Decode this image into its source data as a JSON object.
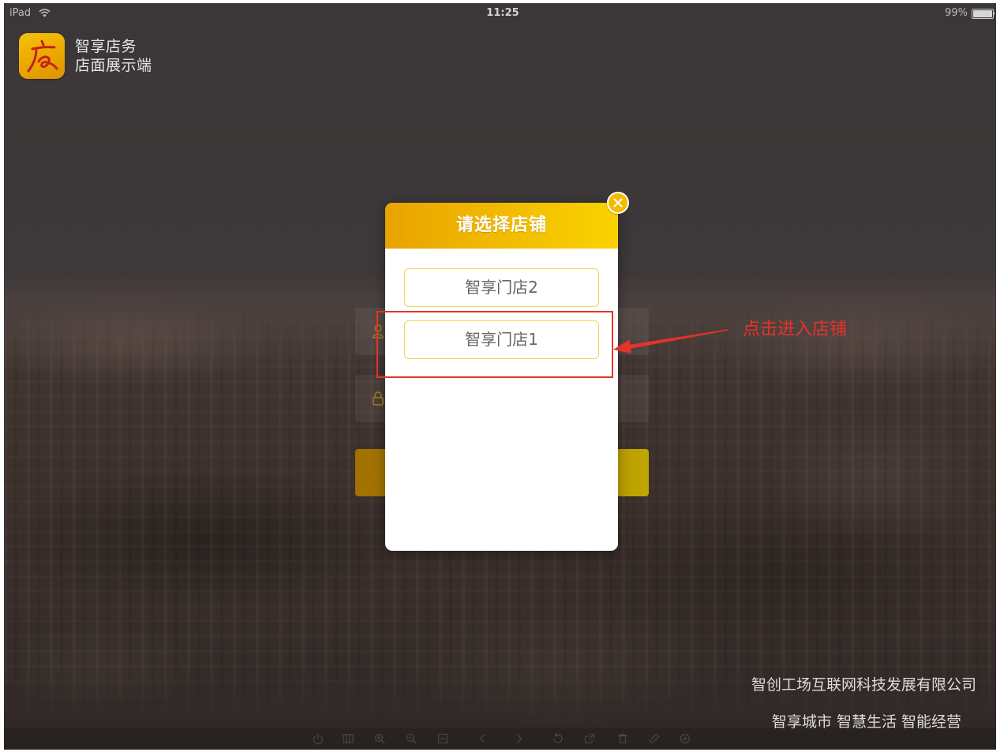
{
  "status_bar": {
    "device": "iPad",
    "wifi_icon": "wifi-icon",
    "time": "11:25",
    "battery": "99%",
    "battery_icon": "battery-icon",
    "battery_level": 0.99
  },
  "app": {
    "logo_icon": "store-logo-icon",
    "name": "智享店务",
    "subtitle": "店面展示端"
  },
  "login_form": {
    "username_icon": "user-icon",
    "password_icon": "lock-icon"
  },
  "modal": {
    "title": "请选择店铺",
    "close_icon": "close-icon",
    "stores": [
      {
        "label": "智享门店2"
      },
      {
        "label": "智享门店1"
      }
    ]
  },
  "annotation": {
    "text": "点击进入店铺"
  },
  "footer": {
    "company": "智创工场互联网科技发展有限公司",
    "slogan": "智享城市 智慧生活 智能经营"
  },
  "viewer_toolbar": {
    "icons": [
      "power-icon",
      "grid-icon",
      "zoom-in-icon",
      "zoom-out-icon",
      "fit-icon",
      "chevron-left-icon",
      "chevron-right-icon",
      "rotate-icon",
      "expand-icon",
      "trash-icon",
      "edit-icon",
      "share-icon"
    ]
  },
  "colors": {
    "accent": "#f2b200",
    "store_border": "#f3d35c",
    "annotation": "#e5332b",
    "header_left": "#e9a300",
    "header_right": "#fad200",
    "login_button_left": "#a27000",
    "login_button_right": "#c0a600"
  }
}
